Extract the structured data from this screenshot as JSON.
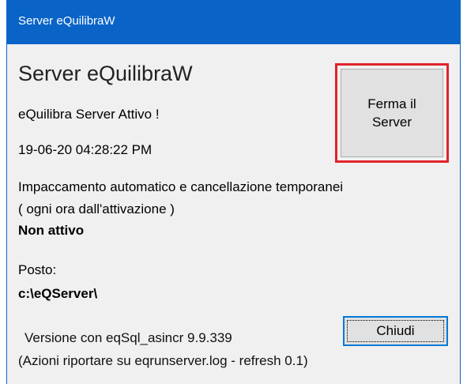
{
  "window": {
    "title": "Server eQuilibraW"
  },
  "main": {
    "heading": "Server eQuilibraW",
    "status": "eQuilibra Server Attivo !",
    "timestamp": "19-06-20 04:28:22 PM",
    "auto_pack_label": "Impaccamento automatico e cancellazione temporanei",
    "auto_pack_note": "( ogni ora dall'attivazione )",
    "auto_pack_state": "Non attivo",
    "location_label": "Posto:",
    "location_value": "c:\\eQServer\\"
  },
  "buttons": {
    "stop_line1": "Ferma il",
    "stop_line2": "Server",
    "close": "Chiudi"
  },
  "footer": {
    "version": "Versione con eqSql_asincr 9.9.339",
    "log_note": "(Azioni riportare su eqrunserver.log - refresh 0.1)"
  },
  "colors": {
    "titlebar": "#0a64c8",
    "highlight_border": "#e0232a",
    "focus_border": "#0078d7",
    "window_bg": "#f0f0f0"
  }
}
